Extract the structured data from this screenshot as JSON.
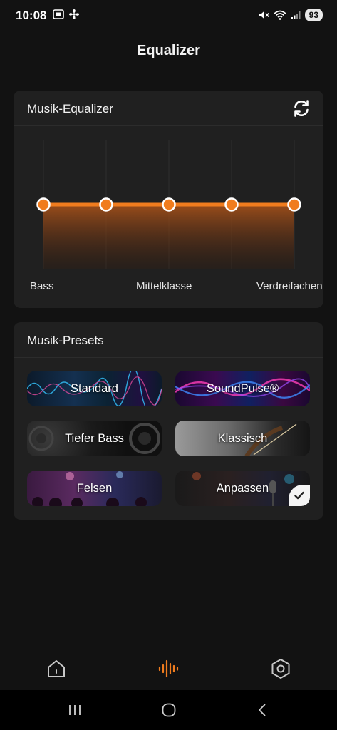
{
  "status_bar": {
    "time": "10:08",
    "battery": "93"
  },
  "page": {
    "title": "Equalizer"
  },
  "equalizer_card": {
    "title": "Musik-Equalizer",
    "refresh_icon": "refresh-icon",
    "bands": [
      {
        "index": 1,
        "level": 0
      },
      {
        "index": 2,
        "level": 0
      },
      {
        "index": 3,
        "level": 0
      },
      {
        "index": 4,
        "level": 0
      },
      {
        "index": 5,
        "level": 0
      }
    ],
    "labels": {
      "bass": "Bass",
      "mid": "Mittelklasse",
      "treble": "Verdreifachen"
    },
    "accent_color": "#f07c1e"
  },
  "presets_card": {
    "title": "Musik-Presets",
    "presets": [
      {
        "label": "Standard",
        "selected": false
      },
      {
        "label": "SoundPulse®",
        "selected": false
      },
      {
        "label": "Tiefer Bass",
        "selected": false
      },
      {
        "label": "Klassisch",
        "selected": false
      },
      {
        "label": "Felsen",
        "selected": false
      },
      {
        "label": "Anpassen",
        "selected": true
      }
    ]
  },
  "bottom_nav": {
    "items": [
      {
        "icon": "home-icon",
        "active": false
      },
      {
        "icon": "equalizer-icon",
        "active": true
      },
      {
        "icon": "settings-icon",
        "active": false
      }
    ],
    "active_color": "#f07c1e",
    "inactive_color": "#c8c8c8"
  },
  "system_nav": {
    "items": [
      {
        "icon": "recents-icon"
      },
      {
        "icon": "home-circle-icon"
      },
      {
        "icon": "back-icon"
      }
    ]
  }
}
